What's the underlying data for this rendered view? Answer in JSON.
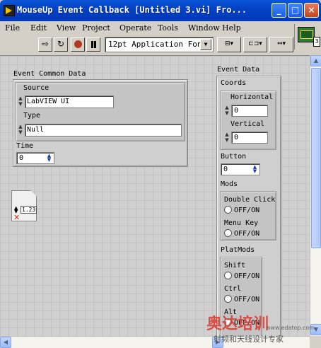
{
  "window": {
    "title": "MouseUp Event Callback [Untitled 3.vi] Fro...",
    "min": "_",
    "max": "□",
    "close": "×"
  },
  "menu": [
    "File",
    "Edit",
    "View",
    "Project",
    "Operate",
    "Tools",
    "Window",
    "Help"
  ],
  "toolbar": {
    "font": "12pt Application Font",
    "connector_label": "3"
  },
  "event_common_data": {
    "label": "Event Common Data",
    "source_label": "Source",
    "source_value": "LabVIEW UI",
    "type_label": "Type",
    "type_value": "Null",
    "time_label": "Time",
    "time_value": "0"
  },
  "ref_control": {
    "label": "1.23"
  },
  "event_data": {
    "label": "Event Data",
    "coords_label": "Coords",
    "horizontal_label": "Horizontal",
    "horizontal_value": "0",
    "vertical_label": "Vertical",
    "vertical_value": "0",
    "button_label": "Button",
    "button_value": "0",
    "mods_label": "Mods",
    "double_click_label": "Double Click",
    "double_click_value": "OFF/ON",
    "menu_key_label": "Menu Key",
    "menu_key_value": "OFF/ON",
    "platmods_label": "PlatMods",
    "shift_label": "Shift",
    "shift_value": "OFF/ON",
    "ctrl_label": "Ctrl",
    "ctrl_value": "OFF/ON",
    "alt_label": "Alt",
    "alt_value": "OFF/ON"
  },
  "watermark": {
    "big": "奥达培训",
    "small": "射频和天线设计专家",
    "url": "www.edatop.com"
  }
}
